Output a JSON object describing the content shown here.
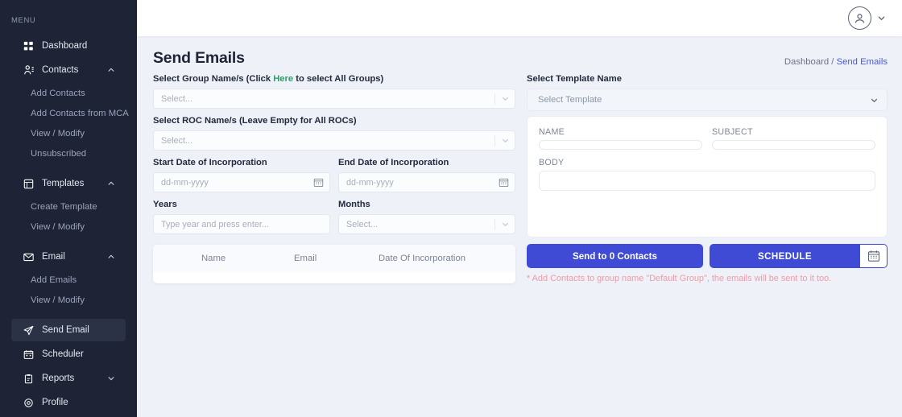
{
  "sidebar": {
    "menu_label": "MENU",
    "items": [
      {
        "label": "Dashboard",
        "icon": "grid-icon",
        "type": "item",
        "expandable": false,
        "active": false
      },
      {
        "label": "Contacts",
        "icon": "contacts-icon",
        "type": "item",
        "expandable": true,
        "chevron": "chevron-up-icon",
        "active": false
      },
      {
        "label": "Add Contacts",
        "type": "sub"
      },
      {
        "label": "Add Contacts from MCA",
        "type": "sub"
      },
      {
        "label": "View / Modify",
        "type": "sub"
      },
      {
        "label": "Unsubscribed",
        "type": "sub"
      },
      {
        "label": "Templates",
        "icon": "templates-icon",
        "type": "item",
        "expandable": true,
        "chevron": "chevron-up-icon",
        "active": false
      },
      {
        "label": "Create Template",
        "type": "sub"
      },
      {
        "label": "View / Modify",
        "type": "sub"
      },
      {
        "label": "Email",
        "icon": "envelope-icon",
        "type": "item",
        "expandable": true,
        "chevron": "chevron-up-icon",
        "active": false
      },
      {
        "label": "Add Emails",
        "type": "sub"
      },
      {
        "label": "View / Modify",
        "type": "sub"
      },
      {
        "label": "Send Email",
        "icon": "paper-plane-icon",
        "type": "item",
        "expandable": false,
        "active": true
      },
      {
        "label": "Scheduler",
        "icon": "calendar-icon",
        "type": "item",
        "expandable": false,
        "active": false
      },
      {
        "label": "Reports",
        "icon": "clipboard-icon",
        "type": "item",
        "expandable": true,
        "chevron": "chevron-down-icon",
        "active": false
      },
      {
        "label": "Profile",
        "icon": "gear-icon",
        "type": "item",
        "expandable": false,
        "active": false
      }
    ]
  },
  "topbar": {
    "avatar_icon": "user-circle-icon",
    "caret_icon": "chevron-down-icon"
  },
  "page": {
    "title": "Send Emails",
    "breadcrumb_root": "Dashboard",
    "breadcrumb_sep": "/",
    "breadcrumb_current": "Send Emails"
  },
  "left": {
    "group_label_pre": "Select Group Name/s (Click ",
    "group_label_link": "Here",
    "group_label_post": " to select All Groups)",
    "group_placeholder": "Select...",
    "roc_label": "Select ROC Name/s (Leave Empty for All ROCs)",
    "roc_placeholder": "Select...",
    "start_date_label": "Start Date of Incorporation",
    "start_date_placeholder": "dd-mm-yyyy",
    "end_date_label": "End Date of Incorporation",
    "end_date_placeholder": "dd-mm-yyyy",
    "years_label": "Years",
    "years_placeholder": "Type year and press enter...",
    "months_label": "Months",
    "months_placeholder": "Select...",
    "table_headers": [
      "Name",
      "Email",
      "Date Of Incorporation"
    ],
    "table_rows": []
  },
  "right": {
    "template_label": "Select Template Name",
    "template_placeholder": "Select Template",
    "name_label": "NAME",
    "name_value": "",
    "subject_label": "SUBJECT",
    "subject_value": "",
    "body_label": "BODY",
    "body_value": "",
    "send_button": "Send to 0 Contacts",
    "schedule_button": "SCHEDULE",
    "schedule_calendar_icon": "calendar-icon",
    "note": "* Add Contacts to group name \"Default Group\", the emails will be sent to it too."
  },
  "colors": {
    "sidebar_bg": "#1e2436",
    "accent": "#3f4bd4",
    "link_green": "#2e9e6b",
    "note_red": "#f19ba6",
    "page_bg": "#eef1f7"
  }
}
